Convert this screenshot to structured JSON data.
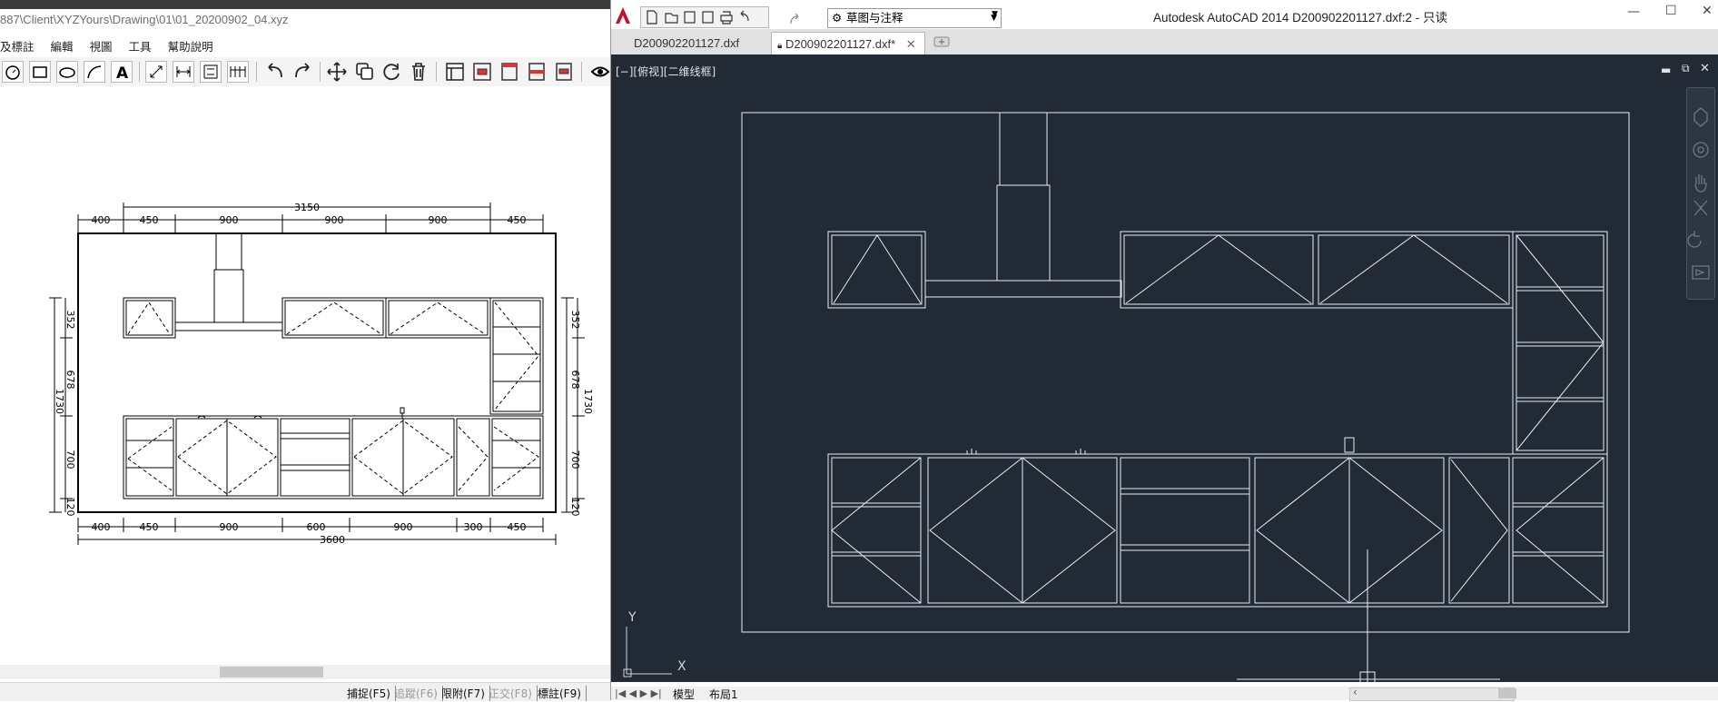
{
  "left_app": {
    "title": "887\\Client\\XYZYours\\Drawing\\01\\01_20200902_04.xyz",
    "menu": [
      "及標註",
      "編輯",
      "視圖",
      "工具",
      "幫助說明"
    ],
    "drawing": {
      "top_dims": [
        "400",
        "450",
        "900",
        "900",
        "900",
        "450"
      ],
      "top_total": "3150",
      "bottom_dims": [
        "400",
        "450",
        "900",
        "600",
        "900",
        "300",
        "450"
      ],
      "bottom_total": "3600",
      "side_dims": [
        "352",
        "678",
        "700",
        "120"
      ],
      "side_total": "1730"
    },
    "status": [
      {
        "label": "捕捉(F5)",
        "active": true
      },
      {
        "label": "追蹤(F6)",
        "active": false
      },
      {
        "label": "限附(F7)",
        "active": true
      },
      {
        "label": "正交(F8)",
        "active": false
      },
      {
        "label": "標註(F9)",
        "active": true
      }
    ]
  },
  "acad": {
    "workspace": "草图与注释",
    "title": "Autodesk AutoCAD 2014     D200902201127.dxf:2 - 只读",
    "tabs": [
      "D200902201127.dxf",
      "D200902201127.dxf*"
    ],
    "viewport_label": "[−][俯视][二维线框]",
    "layout_tabs": [
      "模型",
      "布局1"
    ],
    "ucs_x": "X",
    "ucs_y": "Y"
  }
}
